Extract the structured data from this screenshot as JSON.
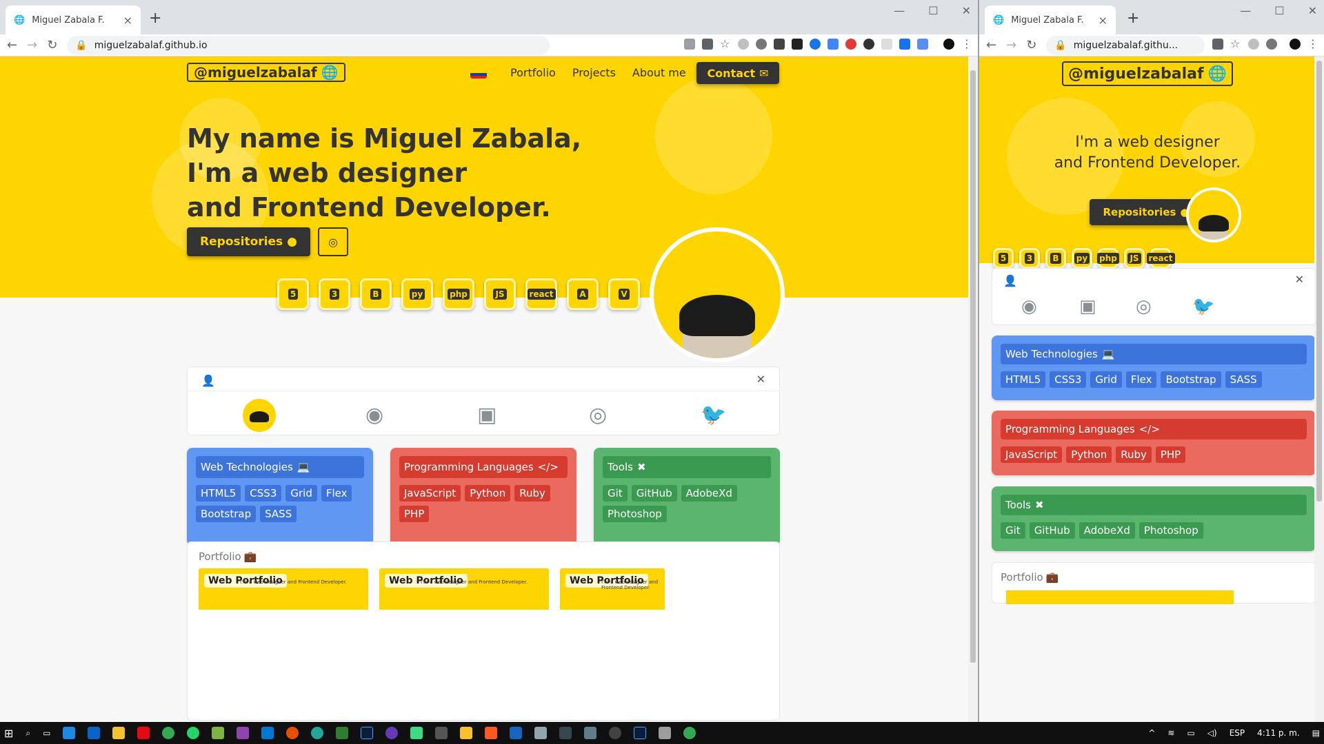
{
  "colors": {
    "accent": "#ffd500",
    "dark": "#333333",
    "blue": "#6097f3",
    "red": "#eb6a5f",
    "green": "#5bb56e"
  },
  "browser": {
    "tab_title": "Miguel Zabala F.",
    "url_left": "miguelzabalaf.github.io",
    "url_right": "miguelzabalaf.githu..."
  },
  "site": {
    "brand": "@miguelzabalaf",
    "nav": [
      "Portfolio",
      "Projects",
      "About me"
    ],
    "contact": "Contact",
    "hero_line1": "My name is Miguel Zabala,",
    "hero_line2": "I'm a web designer",
    "hero_line3": "and Frontend Developer.",
    "mobile_line1": "I'm a web designer",
    "mobile_line2": "and Frontend Developer.",
    "repos_button": "Repositories",
    "tech_icons": [
      "5",
      "3",
      "B",
      "py",
      "php",
      "JS",
      "react",
      "A",
      "V"
    ],
    "web_tech": {
      "title": "Web Technologies",
      "items": [
        "HTML5",
        "CSS3",
        "Grid",
        "Flex",
        "Bootstrap",
        "SASS"
      ]
    },
    "prog_lang": {
      "title": "Programming Languages",
      "items": [
        "JavaScript",
        "Python",
        "Ruby",
        "PHP"
      ]
    },
    "tools": {
      "title": "Tools",
      "items": [
        "Git",
        "GitHub",
        "AdobeXd",
        "Photoshop"
      ]
    },
    "portfolio_title": "Portfolio",
    "portfolio_items": [
      "Web Portfolio",
      "Web Portfolio",
      "Web Portfolio"
    ],
    "thumb_text": "I'm a web designer and Frontend Developer."
  },
  "taskbar": {
    "lang": "ESP",
    "time": "4:11 p. m."
  }
}
